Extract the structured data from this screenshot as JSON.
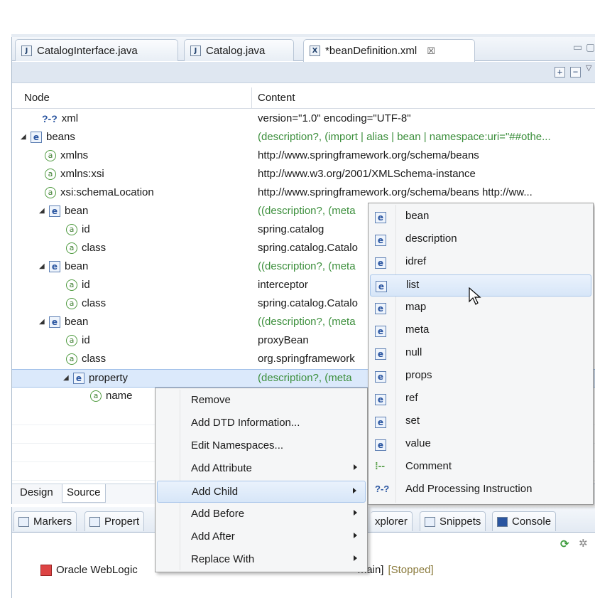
{
  "editor_tabs": [
    {
      "icon": "J",
      "label": "CatalogInterface.java"
    },
    {
      "icon": "J",
      "label": "Catalog.java"
    },
    {
      "icon": "X",
      "label": "*beanDefinition.xml",
      "close": "☒"
    }
  ],
  "window_controls": {
    "minimize": "▭",
    "maximize": "▢"
  },
  "toolbar": {
    "expand_all": "+",
    "collapse_all": "−",
    "menu": "▽"
  },
  "tree": {
    "headers": {
      "node": "Node",
      "content": "Content"
    },
    "rows": [
      {
        "kind": "pi",
        "icon": "?-?",
        "name": "xml",
        "content": "version=\"1.0\" encoding=\"UTF-8\"",
        "muted": false
      },
      {
        "kind": "element",
        "icon": "e",
        "name": "beans",
        "content": "(description?, (import | alias | bean | namespace:uri=\"##othe...",
        "muted": true
      },
      {
        "kind": "attr",
        "icon": "a",
        "name": "xmlns",
        "content": "http://www.springframework.org/schema/beans",
        "muted": false
      },
      {
        "kind": "attr",
        "icon": "a",
        "name": "xmlns:xsi",
        "content": "http://www.w3.org/2001/XMLSchema-instance",
        "muted": false
      },
      {
        "kind": "attr",
        "icon": "a",
        "name": "xsi:schemaLocation",
        "content": "http://www.springframework.org/schema/beans http://ww...",
        "muted": false
      },
      {
        "kind": "element",
        "icon": "e",
        "name": "bean",
        "content": "((description?, (meta",
        "muted": true
      },
      {
        "kind": "attr",
        "icon": "a",
        "name": "id",
        "content": "spring.catalog",
        "muted": false
      },
      {
        "kind": "attr",
        "icon": "a",
        "name": "class",
        "content": "spring.catalog.Catalo",
        "muted": false
      },
      {
        "kind": "element",
        "icon": "e",
        "name": "bean",
        "content": "((description?, (meta",
        "muted": true
      },
      {
        "kind": "attr",
        "icon": "a",
        "name": "id",
        "content": "interceptor",
        "muted": false
      },
      {
        "kind": "attr",
        "icon": "a",
        "name": "class",
        "content": "spring.catalog.Catalo",
        "muted": false
      },
      {
        "kind": "element",
        "icon": "e",
        "name": "bean",
        "content": "((description?, (meta",
        "muted": true
      },
      {
        "kind": "attr",
        "icon": "a",
        "name": "id",
        "content": "proxyBean",
        "muted": false
      },
      {
        "kind": "attr",
        "icon": "a",
        "name": "class",
        "content": "org.springframework",
        "muted": false
      },
      {
        "kind": "element",
        "icon": "e",
        "name": "property",
        "content": "(description?, (meta",
        "muted": true,
        "selected": true
      },
      {
        "kind": "attr",
        "icon": "a",
        "name": "name",
        "content": "",
        "muted": false
      }
    ]
  },
  "design_tabs": {
    "design": "Design",
    "source": "Source"
  },
  "context_menu": [
    {
      "label": "Remove",
      "submenu": false
    },
    {
      "label": "Add DTD Information...",
      "submenu": false
    },
    {
      "label": "Edit Namespaces...",
      "submenu": false
    },
    {
      "label": "Add Attribute",
      "submenu": true
    },
    {
      "label": "Add Child",
      "submenu": true,
      "highlighted": true
    },
    {
      "label": "Add Before",
      "submenu": true
    },
    {
      "label": "Add After",
      "submenu": true
    },
    {
      "label": "Replace With",
      "submenu": true
    }
  ],
  "submenu": [
    {
      "icon": "e",
      "label": "bean"
    },
    {
      "icon": "e",
      "label": "description"
    },
    {
      "icon": "e",
      "label": "idref"
    },
    {
      "icon": "e",
      "label": "list",
      "highlighted": true
    },
    {
      "icon": "e",
      "label": "map"
    },
    {
      "icon": "e",
      "label": "meta"
    },
    {
      "icon": "e",
      "label": "null"
    },
    {
      "icon": "e",
      "label": "props"
    },
    {
      "icon": "e",
      "label": "ref"
    },
    {
      "icon": "e",
      "label": "set"
    },
    {
      "icon": "e",
      "label": "value"
    },
    {
      "icon": "comment",
      "label": "Comment"
    },
    {
      "icon": "?-?",
      "label": "Add Processing Instruction"
    }
  ],
  "bottom_tabs": [
    {
      "label": "Markers"
    },
    {
      "label": "Propert"
    },
    {
      "label": "xplorer"
    },
    {
      "label": "Snippets"
    },
    {
      "label": "Console"
    }
  ],
  "server": {
    "name": "Oracle WebLogic",
    "domain_fragment": "main]",
    "state": "[Stopped]"
  }
}
